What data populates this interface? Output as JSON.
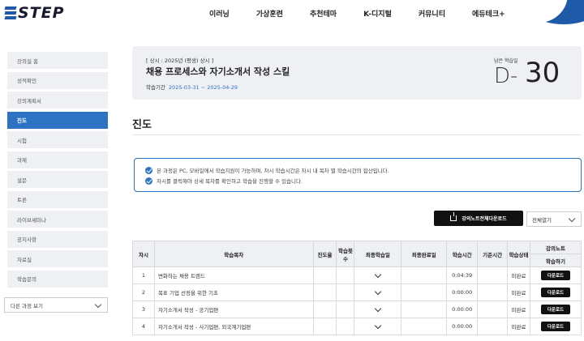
{
  "header": {
    "logo_text": "STEP",
    "nav": [
      "이러닝",
      "가상훈련",
      "추천테마",
      "K-디지털",
      "커뮤니티",
      "에듀테크+"
    ]
  },
  "sidebar": {
    "items": [
      "강의실 홈",
      "성적확인",
      "강의계획서",
      "진도",
      "시험",
      "과제",
      "설문",
      "토론",
      "라이브세미나",
      "공지사항",
      "자료실",
      "학습문의"
    ],
    "active_index": 3,
    "course_select": "다른 과정 보기"
  },
  "course": {
    "category": "[ 상시 : 2025년 (평생) 상시 ]",
    "title": "채용 프로세스와 자기소개서 작성 스킬",
    "period_label": "학습기간",
    "period_dates": "2025-03-31 ~ 2025-04-29",
    "remaining_label": "남은 학습일",
    "dday_prefix": "D-",
    "dday_value": "30"
  },
  "page_title": "진도",
  "notice": [
    "본 과정은 PC, 모바일에서 학습지원이 가능하며, 차시 학습시간은 차시 내 목차 별 학습시간의 합산입니다.",
    "차시를 클릭해야 상세 목차를 확인하고 학습을 진행할 수 있습니다."
  ],
  "actions": {
    "note_download": "강의노트전체다운로드",
    "expand_select": "전체열기"
  },
  "table": {
    "headers": {
      "no": "차시",
      "title": "학습목차",
      "progress": "진도율",
      "count": "학습횟수",
      "last_study": "최종학습일",
      "last_done": "최종완료일",
      "time": "학습시간",
      "base_time": "기준시간",
      "status": "학습상태",
      "note_group": "강의노트",
      "note_sub": "학습하기"
    },
    "rows": [
      {
        "no": "1",
        "title": "변화하는 채용 트렌드",
        "time": "0:04:39",
        "status": "미완료",
        "download": "다운로드"
      },
      {
        "no": "2",
        "title": "목표 기업 선정을 위한 기초",
        "time": "0:00:00",
        "status": "미완료",
        "download": "다운로드"
      },
      {
        "no": "3",
        "title": "자기소개서 작성 - 공기업편",
        "time": "0:00:00",
        "status": "미완료",
        "download": "다운로드"
      },
      {
        "no": "4",
        "title": "자기소개서 작성 - 사기업편, 외국계기업편",
        "time": "0:00:00",
        "status": "미완료",
        "download": "다운로드"
      }
    ]
  }
}
